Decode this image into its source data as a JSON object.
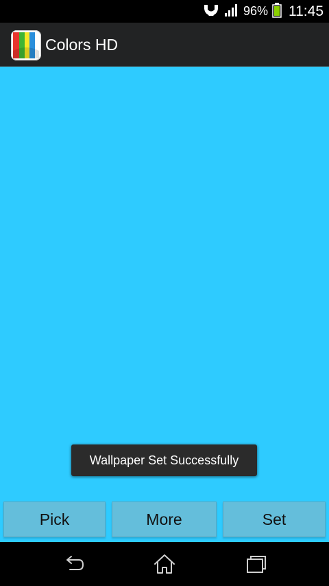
{
  "status_bar": {
    "battery_percent": "96%",
    "time": "11:45",
    "icons": [
      "nfc-icon",
      "signal-icon",
      "battery-icon"
    ]
  },
  "action_bar": {
    "title": "Colors HD",
    "icon": "app-icon"
  },
  "content": {
    "background_color": "#2ecbff"
  },
  "toast": {
    "message": "Wallpaper Set Successfully"
  },
  "buttons": {
    "pick": "Pick",
    "more": "More",
    "set": "Set"
  },
  "nav_bar": {
    "icons": [
      "back-icon",
      "home-icon",
      "recent-apps-icon"
    ]
  }
}
